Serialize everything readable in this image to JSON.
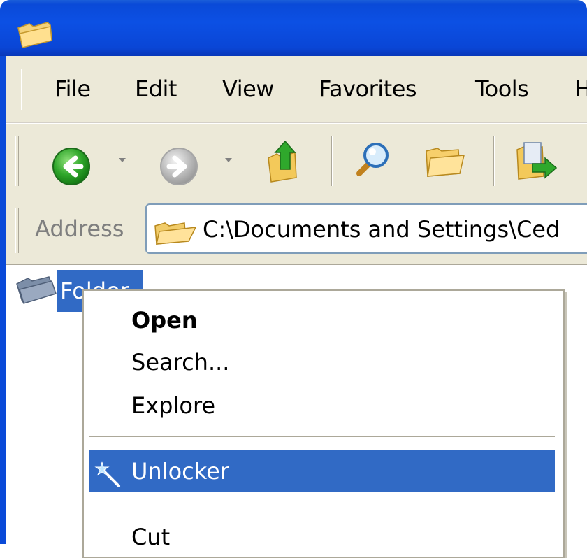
{
  "window": {
    "title_icon": "folder-icon"
  },
  "menubar": {
    "items": [
      "File",
      "Edit",
      "View",
      "Favorites",
      "Tools",
      "H"
    ]
  },
  "toolbar": {
    "buttons": [
      {
        "name": "back-button",
        "icon": "green-back-arrow-icon"
      },
      {
        "name": "forward-button",
        "icon": "gray-forward-arrow-icon"
      },
      {
        "name": "up-button",
        "icon": "folder-up-icon"
      },
      {
        "name": "search-button",
        "icon": "magnifier-icon"
      },
      {
        "name": "folders-button",
        "icon": "folder-icon"
      },
      {
        "name": "move-to-button",
        "icon": "move-to-icon"
      }
    ]
  },
  "address": {
    "label": "Address",
    "path": "C:\\Documents and Settings\\Ced"
  },
  "content": {
    "folder_label": "Folder"
  },
  "context_menu": {
    "items": [
      {
        "label": "Open",
        "bold": true
      },
      {
        "label": "Search..."
      },
      {
        "label": "Explore"
      },
      {
        "label": "Unlocker",
        "highlighted": true,
        "icon": "magic-wand-icon"
      },
      {
        "label": "Cut"
      }
    ]
  },
  "colors": {
    "title_blue": "#0a4ad8",
    "selection_blue": "#316ac5",
    "chrome_beige": "#ece9d8"
  }
}
